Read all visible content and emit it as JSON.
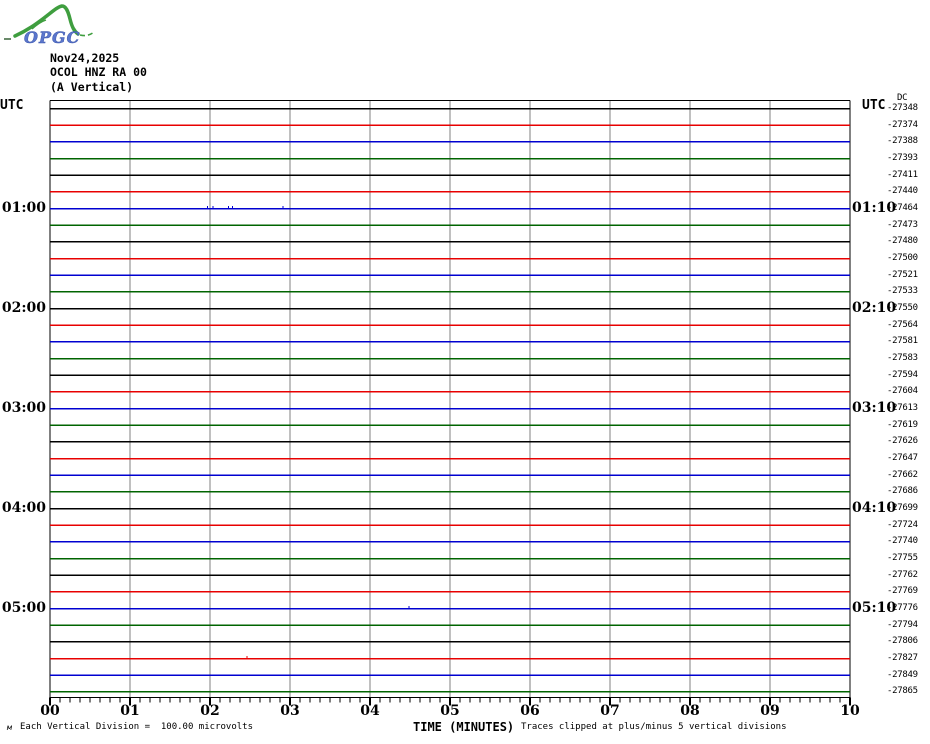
{
  "logo": {
    "text": "OPGC",
    "curve_color": "#3f9e3f",
    "text_color": "#5b76cc"
  },
  "header": {
    "date": "Nov24,2025",
    "station": "OCOL HNZ RA 00",
    "component": "(A Vertical)"
  },
  "axis": {
    "left_utc": "UTC",
    "right_utc": "UTC",
    "dc_header": "DC",
    "xlabel": "TIME (MINUTES)",
    "minute_labels": [
      "00",
      "01",
      "02",
      "03",
      "04",
      "05",
      "06",
      "07",
      "08",
      "09",
      "10"
    ]
  },
  "footer": {
    "left_glyph": "м",
    "scale_note": "Each Vertical Division =  100.00 microvolts",
    "clip_note": "Traces clipped at plus/minus 5 vertical divisions"
  },
  "chart_data": {
    "type": "line",
    "title": "OCOL HNZ RA 00 (A Vertical) helicorder, Nov24,2025",
    "xlabel": "TIME (MINUTES)",
    "x_range_minutes": [
      0,
      10
    ],
    "minutes_per_row": 10,
    "minor_divisions_per_minute": 8,
    "row_count": 36,
    "start_time_utc": "00:00",
    "trace_color_cycle": [
      "#000000",
      "#e80000",
      "#0000d0",
      "#006400"
    ],
    "grid_color": "#808080",
    "border_color": "#000000",
    "traces_flat": true,
    "dc_offsets": [
      -27348,
      -27374,
      -27388,
      -27393,
      -27411,
      -27440,
      -27464,
      -27473,
      -27480,
      -27500,
      -27521,
      -27533,
      -27550,
      -27564,
      -27581,
      -27583,
      -27594,
      -27604,
      -27613,
      -27619,
      -27626,
      -27647,
      -27662,
      -27686,
      -27699,
      -27724,
      -27740,
      -27755,
      -27762,
      -27769,
      -27776,
      -27794,
      -27806,
      -27827,
      -27849,
      -27865
    ],
    "hour_rows": [
      {
        "row": 7,
        "left": "01:00",
        "right": "01:10"
      },
      {
        "row": 13,
        "left": "02:00",
        "right": "02:10"
      },
      {
        "row": 19,
        "left": "03:00",
        "right": "03:10"
      },
      {
        "row": 25,
        "left": "04:00",
        "right": "04:10"
      },
      {
        "row": 31,
        "left": "05:00",
        "right": "05:10"
      }
    ],
    "noise_marks": [
      {
        "row": 7,
        "minutes": [
          1.97,
          2.04,
          2.23,
          2.28,
          2.91
        ]
      },
      {
        "row": 31,
        "minutes": [
          4.49
        ]
      },
      {
        "row": 34,
        "minutes": [
          2.46
        ]
      }
    ]
  }
}
